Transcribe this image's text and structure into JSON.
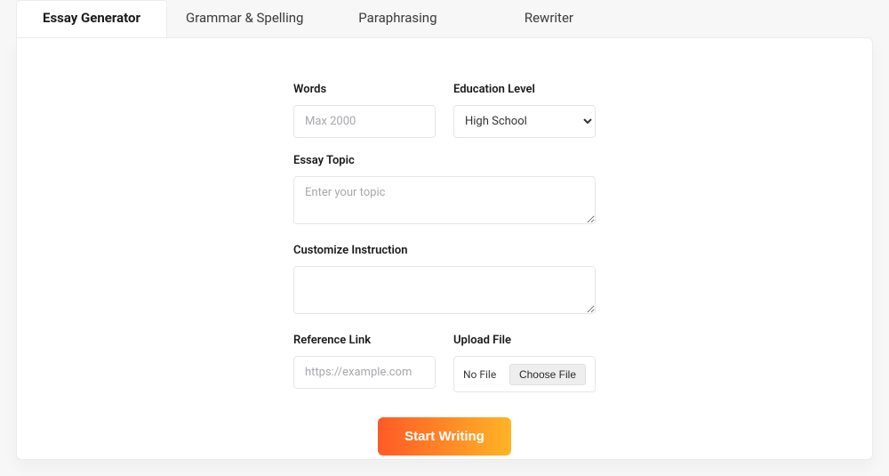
{
  "tabs": {
    "essay_generator": "Essay Generator",
    "grammar_spelling": "Grammar & Spelling",
    "paraphrasing": "Paraphrasing",
    "rewriter": "Rewriter"
  },
  "form": {
    "words_label": "Words",
    "words_placeholder": "Max 2000",
    "education_label": "Education Level",
    "education_value": "High School",
    "topic_label": "Essay Topic",
    "topic_placeholder": "Enter your topic",
    "customize_label": "Customize Instruction",
    "reference_label": "Reference Link",
    "reference_placeholder": "https://example.com",
    "upload_label": "Upload File",
    "no_file_text": "No File",
    "choose_file_button": "Choose File",
    "submit_label": "Start Writing"
  }
}
